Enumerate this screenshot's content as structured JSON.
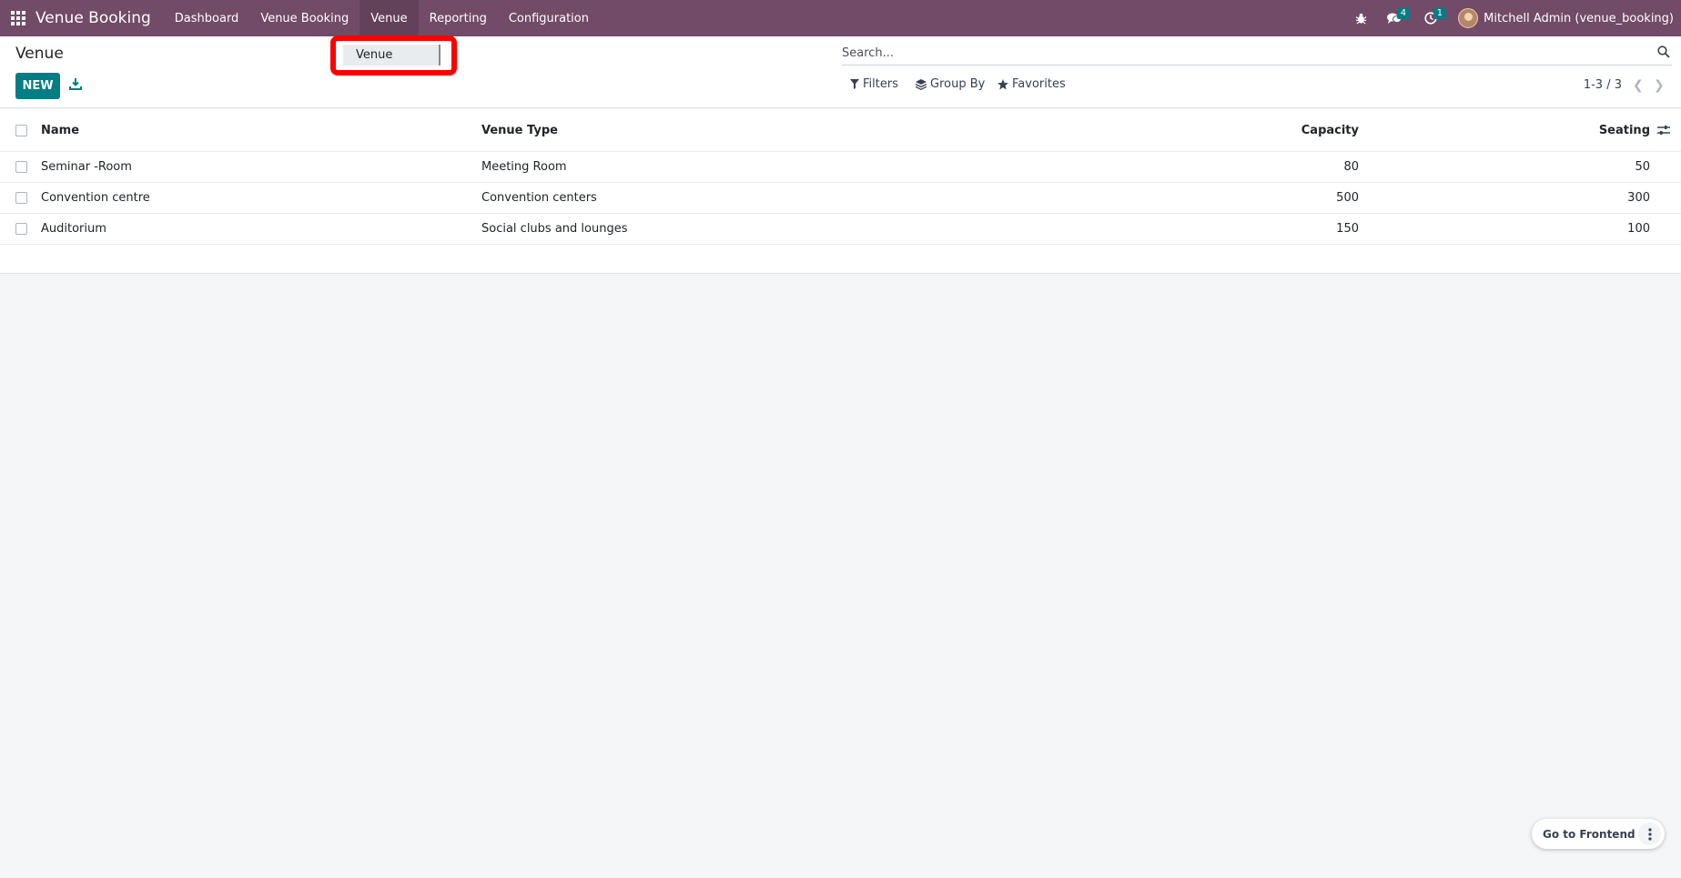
{
  "navbar": {
    "app_name": "Venue Booking",
    "menu": [
      "Dashboard",
      "Venue Booking",
      "Venue",
      "Reporting",
      "Configuration"
    ],
    "messages_count": "4",
    "activities_count": "1",
    "user_name": "Mitchell Admin (venue_booking)"
  },
  "dropdown": {
    "item": "Venue"
  },
  "control_panel": {
    "title": "Venue",
    "new_label": "NEW",
    "search_placeholder": "Search...",
    "filters_label": "Filters",
    "group_by_label": "Group By",
    "favorites_label": "Favorites",
    "pager": "1-3 / 3"
  },
  "list": {
    "columns": {
      "name": "Name",
      "venue_type": "Venue Type",
      "capacity": "Capacity",
      "seating": "Seating"
    },
    "rows": [
      {
        "name": "Seminar -Room",
        "venue_type": "Meeting Room",
        "capacity": "80",
        "seating": "50"
      },
      {
        "name": "Convention centre",
        "venue_type": "Convention centers",
        "capacity": "500",
        "seating": "300"
      },
      {
        "name": "Auditorium",
        "venue_type": "Social clubs and lounges",
        "capacity": "150",
        "seating": "100"
      }
    ]
  },
  "frontend": {
    "label": "Go to Frontend"
  },
  "colors": {
    "navbar": "#714b67",
    "primary": "#017e84",
    "highlight": "#ff0000"
  }
}
